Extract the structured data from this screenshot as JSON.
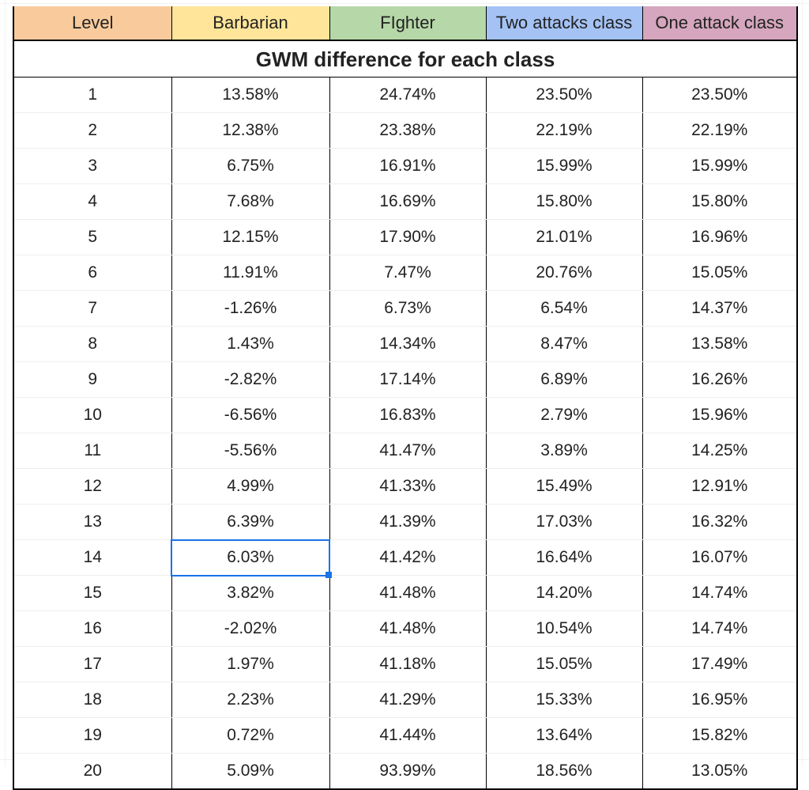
{
  "title": "GWM difference for each class",
  "columns": [
    "Level",
    "Barbarian",
    "FIghter",
    "Two attacks class",
    "One attack class"
  ],
  "headerColors": {
    "level": "#f9cb9c",
    "barb": "#ffe599",
    "fighter": "#b6d7a8",
    "two": "#a4c2f4",
    "one": "#d5a6bd"
  },
  "selected": {
    "row_index": 13,
    "col_index": 1
  },
  "rows": [
    {
      "level": "1",
      "barb": "13.58%",
      "fighter": "24.74%",
      "two": "23.50%",
      "one": "23.50%"
    },
    {
      "level": "2",
      "barb": "12.38%",
      "fighter": "23.38%",
      "two": "22.19%",
      "one": "22.19%"
    },
    {
      "level": "3",
      "barb": "6.75%",
      "fighter": "16.91%",
      "two": "15.99%",
      "one": "15.99%"
    },
    {
      "level": "4",
      "barb": "7.68%",
      "fighter": "16.69%",
      "two": "15.80%",
      "one": "15.80%"
    },
    {
      "level": "5",
      "barb": "12.15%",
      "fighter": "17.90%",
      "two": "21.01%",
      "one": "16.96%"
    },
    {
      "level": "6",
      "barb": "11.91%",
      "fighter": "7.47%",
      "two": "20.76%",
      "one": "15.05%"
    },
    {
      "level": "7",
      "barb": "-1.26%",
      "fighter": "6.73%",
      "two": "6.54%",
      "one": "14.37%"
    },
    {
      "level": "8",
      "barb": "1.43%",
      "fighter": "14.34%",
      "two": "8.47%",
      "one": "13.58%"
    },
    {
      "level": "9",
      "barb": "-2.82%",
      "fighter": "17.14%",
      "two": "6.89%",
      "one": "16.26%"
    },
    {
      "level": "10",
      "barb": "-6.56%",
      "fighter": "16.83%",
      "two": "2.79%",
      "one": "15.96%"
    },
    {
      "level": "11",
      "barb": "-5.56%",
      "fighter": "41.47%",
      "two": "3.89%",
      "one": "14.25%"
    },
    {
      "level": "12",
      "barb": "4.99%",
      "fighter": "41.33%",
      "two": "15.49%",
      "one": "12.91%"
    },
    {
      "level": "13",
      "barb": "6.39%",
      "fighter": "41.39%",
      "two": "17.03%",
      "one": "16.32%"
    },
    {
      "level": "14",
      "barb": "6.03%",
      "fighter": "41.42%",
      "two": "16.64%",
      "one": "16.07%"
    },
    {
      "level": "15",
      "barb": "3.82%",
      "fighter": "41.48%",
      "two": "14.20%",
      "one": "14.74%"
    },
    {
      "level": "16",
      "barb": "-2.02%",
      "fighter": "41.48%",
      "two": "10.54%",
      "one": "14.74%"
    },
    {
      "level": "17",
      "barb": "1.97%",
      "fighter": "41.18%",
      "two": "15.05%",
      "one": "17.49%"
    },
    {
      "level": "18",
      "barb": "2.23%",
      "fighter": "41.29%",
      "two": "15.33%",
      "one": "16.95%"
    },
    {
      "level": "19",
      "barb": "0.72%",
      "fighter": "41.44%",
      "two": "13.64%",
      "one": "15.82%"
    },
    {
      "level": "20",
      "barb": "5.09%",
      "fighter": "93.99%",
      "two": "18.56%",
      "one": "13.05%"
    }
  ],
  "chart_data": {
    "type": "table",
    "title": "GWM difference for each class",
    "columns": [
      "Level",
      "Barbarian",
      "FIghter",
      "Two attacks class",
      "One attack class"
    ],
    "levels": [
      1,
      2,
      3,
      4,
      5,
      6,
      7,
      8,
      9,
      10,
      11,
      12,
      13,
      14,
      15,
      16,
      17,
      18,
      19,
      20
    ],
    "series": [
      {
        "name": "Barbarian",
        "values": [
          13.58,
          12.38,
          6.75,
          7.68,
          12.15,
          11.91,
          -1.26,
          1.43,
          -2.82,
          -6.56,
          -5.56,
          4.99,
          6.39,
          6.03,
          3.82,
          -2.02,
          1.97,
          2.23,
          0.72,
          5.09
        ]
      },
      {
        "name": "FIghter",
        "values": [
          24.74,
          23.38,
          16.91,
          16.69,
          17.9,
          7.47,
          6.73,
          14.34,
          17.14,
          16.83,
          41.47,
          41.33,
          41.39,
          41.42,
          41.48,
          41.48,
          41.18,
          41.29,
          41.44,
          93.99
        ]
      },
      {
        "name": "Two attacks class",
        "values": [
          23.5,
          22.19,
          15.99,
          15.8,
          21.01,
          20.76,
          6.54,
          8.47,
          6.89,
          2.79,
          3.89,
          15.49,
          17.03,
          16.64,
          14.2,
          10.54,
          15.05,
          15.33,
          13.64,
          18.56
        ]
      },
      {
        "name": "One attack class",
        "values": [
          23.5,
          22.19,
          15.99,
          15.8,
          16.96,
          15.05,
          14.37,
          13.58,
          16.26,
          15.96,
          14.25,
          12.91,
          16.32,
          16.07,
          14.74,
          14.74,
          17.49,
          16.95,
          15.82,
          13.05
        ]
      }
    ],
    "unit": "percent"
  }
}
